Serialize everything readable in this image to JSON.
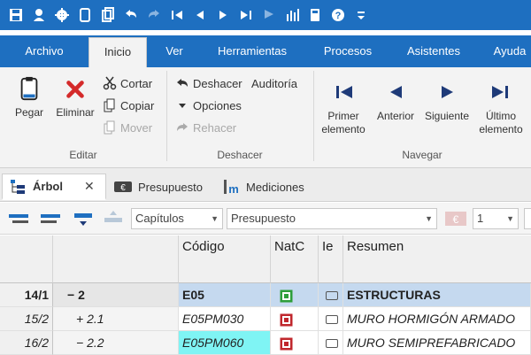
{
  "quick_access": {
    "icons": [
      "save-icon",
      "user-settings-icon",
      "gear-icon",
      "clipboard-icon",
      "copy-icon",
      "undo-icon",
      "redo-icon",
      "first-icon",
      "previous-icon",
      "next-icon",
      "last-icon",
      "flag-icon",
      "chart-icon",
      "calculator-icon",
      "help-icon",
      "customize-icon"
    ]
  },
  "ribbon_tabs": [
    "Archivo",
    "Inicio",
    "Ver",
    "Herramientas",
    "Procesos",
    "Asistentes",
    "Ayuda"
  ],
  "active_tab": "Inicio",
  "ribbon": {
    "edit_group": {
      "label": "Editar",
      "paste": "Pegar",
      "delete": "Eliminar",
      "cut": "Cortar",
      "copy": "Copiar",
      "move": "Mover"
    },
    "undo_group": {
      "label": "Deshacer",
      "undo": "Deshacer",
      "audit": "Auditoría",
      "options": "Opciones",
      "redo": "Rehacer"
    },
    "nav_group": {
      "label": "Navegar",
      "first_l1": "Primer",
      "first_l2": "elemento",
      "previous": "Anterior",
      "next": "Siguiente",
      "last_l1": "Último",
      "last_l2": "elemento"
    }
  },
  "doc_tabs": {
    "tree": "Árbol",
    "budget": "Presupuesto",
    "measurements": "Mediciones",
    "close": "✕"
  },
  "filter_bar": {
    "level_select": "Capítulos",
    "view_select": "Presupuesto",
    "number_select": "1"
  },
  "grid": {
    "headers": {
      "codigo": "Código",
      "natc": "NatC",
      "ie": "Ie",
      "resumen": "Resumen"
    },
    "rows": [
      {
        "rownum": "14/1",
        "tree": "− 2",
        "code": "E05",
        "summary": "ESTRUCTURAS",
        "natc_color": "#2e9e3a"
      },
      {
        "rownum": "15/2",
        "tree": "+ 2.1",
        "code": "E05PM030",
        "summary": "MURO HORMIGÓN ARMADO",
        "natc_color": "#c0272d"
      },
      {
        "rownum": "16/2",
        "tree": "− 2.2",
        "code": "E05PM060",
        "summary": "MURO SEMIPREFABRICADO",
        "natc_color": "#c0272d"
      }
    ]
  },
  "colors": {
    "accent": "#1e6fc0",
    "selected_row": "#c5d9ef",
    "highlight_code": "#7ff4f4"
  }
}
